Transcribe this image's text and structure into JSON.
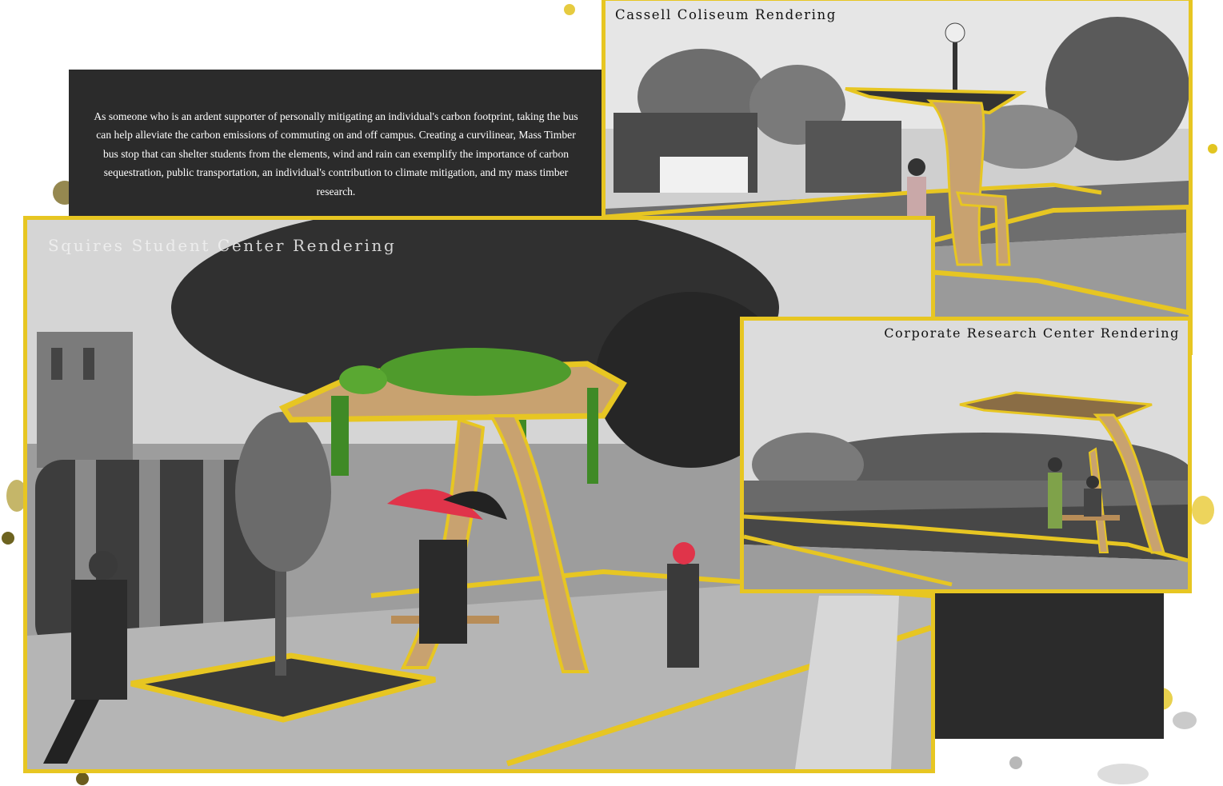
{
  "intro": {
    "text": "As someone who is an ardent supporter of personally mitigating an individual's carbon footprint, taking the bus can help alleviate the carbon emissions of commuting on and off campus. Creating a curvilinear, Mass Timber bus stop that can shelter students from the elements, wind and rain can exemplify the importance of carbon sequestration, public transportation, an individual's contribution to climate mitigation, and my mass timber research."
  },
  "renderings": {
    "cassell": {
      "title": "Cassell Coliseum Rendering"
    },
    "squires": {
      "title": "Squires Student Center Rendering"
    },
    "corporate": {
      "title": "Corporate Research Center Rendering"
    }
  },
  "colors": {
    "accent_yellow": "#e7c622",
    "dark_panel": "#2b2b2b",
    "timber": "#c8a270",
    "umbrella_red": "#e0344a",
    "greenery": "#4f9b2c"
  }
}
